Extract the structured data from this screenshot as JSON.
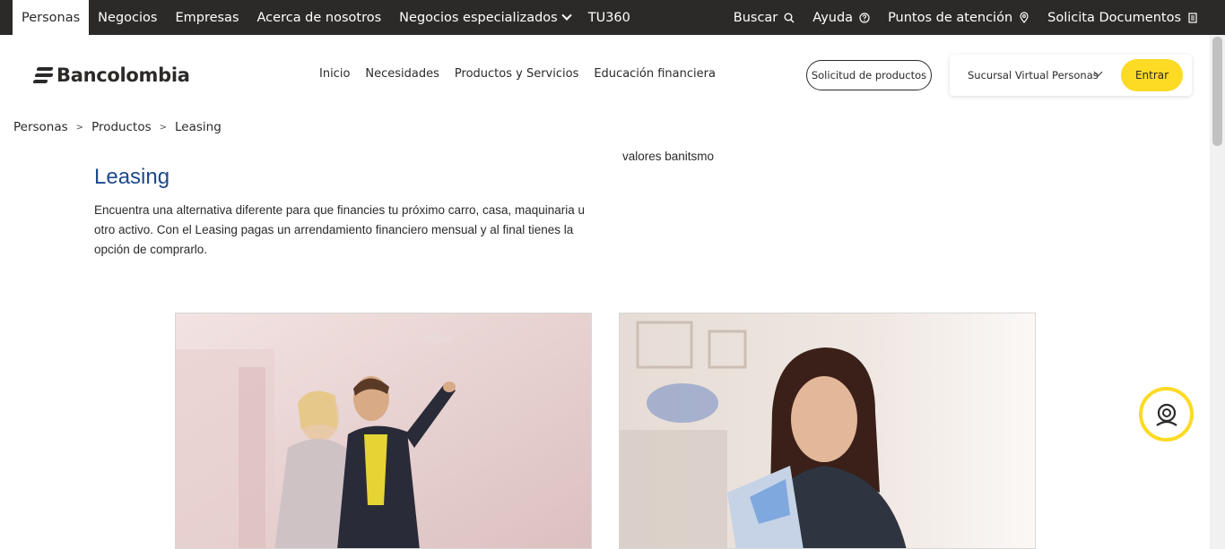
{
  "topbar": {
    "tabs": [
      {
        "label": "Personas",
        "active": true
      },
      {
        "label": "Negocios"
      },
      {
        "label": "Empresas"
      },
      {
        "label": "Acerca de nosotros"
      },
      {
        "label": "Negocios especializados"
      },
      {
        "label": "TU360"
      }
    ],
    "right_items": [
      {
        "label": "Buscar",
        "icon": "search-icon"
      },
      {
        "label": "Ayuda",
        "icon": "help-icon"
      },
      {
        "label": "Puntos de atención",
        "icon": "location-pin-icon"
      },
      {
        "label": "Solicita Documentos",
        "icon": "document-icon"
      }
    ]
  },
  "header": {
    "logo_text": "Bancolombia",
    "nav": [
      "Inicio",
      "Necesidades",
      "Productos y Servicios",
      "Educación financiera"
    ],
    "solicitud_label": "Solicitud de productos",
    "sucursal_label": "Sucursal Virtual Personas",
    "entrar_label": "Entrar"
  },
  "breadcrumb": [
    "Personas",
    "Productos",
    "Leasing"
  ],
  "breadcrumb_sep": ">",
  "hero": {
    "title": "Leasing",
    "description": "Encuentra una alternativa diferente para que financies tu próximo carro, casa, maquinaria u otro activo. Con el Leasing pagas un arrendamiento financiero mensual y al final tienes la opción de comprarlo.",
    "image_alt": "valores banitsmo"
  },
  "colors": {
    "brand_yellow": "#fdda24",
    "title_blue": "#1d4a8c",
    "dark": "#2c2a29"
  }
}
